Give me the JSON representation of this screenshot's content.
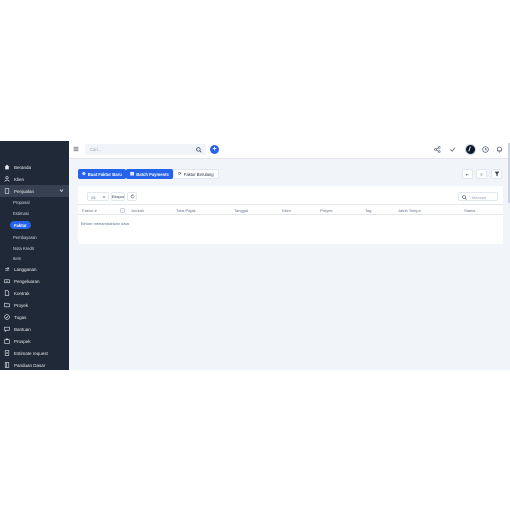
{
  "sidebar": {
    "items": [
      {
        "label": "Beranda",
        "icon": "home-icon"
      },
      {
        "label": "Klien",
        "icon": "user-icon"
      },
      {
        "label": "Penjualan",
        "icon": "document-icon"
      },
      {
        "label": "Langganan",
        "icon": "repeat-icon"
      },
      {
        "label": "Pengeluaran",
        "icon": "money-icon"
      },
      {
        "label": "Kontrak",
        "icon": "file-icon"
      },
      {
        "label": "Proyek",
        "icon": "folder-icon"
      },
      {
        "label": "Tugas",
        "icon": "check-circle-icon"
      },
      {
        "label": "Bantuan",
        "icon": "chat-icon"
      },
      {
        "label": "Prospek",
        "icon": "briefcase-icon"
      },
      {
        "label": "Estimate request",
        "icon": "document-icon"
      },
      {
        "label": "Panduan Dasar",
        "icon": "book-icon"
      }
    ],
    "sub_items": [
      "Proposal",
      "Estimasi",
      "Faktur",
      "Pembayaran",
      "Nota Kredit",
      "Item"
    ],
    "active_sub": "Faktur"
  },
  "topbar": {
    "search_placeholder": "Cari...",
    "add_label": "+"
  },
  "actions": {
    "new_invoice": "Buat Faktur Baru",
    "batch_payments": "Batch Payments",
    "recurring_invoice": "Faktur Berulang",
    "sq1": "⇤",
    "sq2": "≡"
  },
  "table": {
    "page_size": "25",
    "export_label": "Ekspor",
    "search_placeholder": "Mencari",
    "columns": [
      "Faktur #",
      "Jumlah",
      "Total Pajak",
      "Tanggal",
      "Klien",
      "Proyek",
      "Tag",
      "Jatuh Tempo",
      "Status"
    ],
    "empty_message": "Belum menambahkan data"
  },
  "colors": {
    "sidebar_bg": "#1f2937",
    "accent": "#2563eb",
    "page_bg": "#f1f5f9"
  }
}
